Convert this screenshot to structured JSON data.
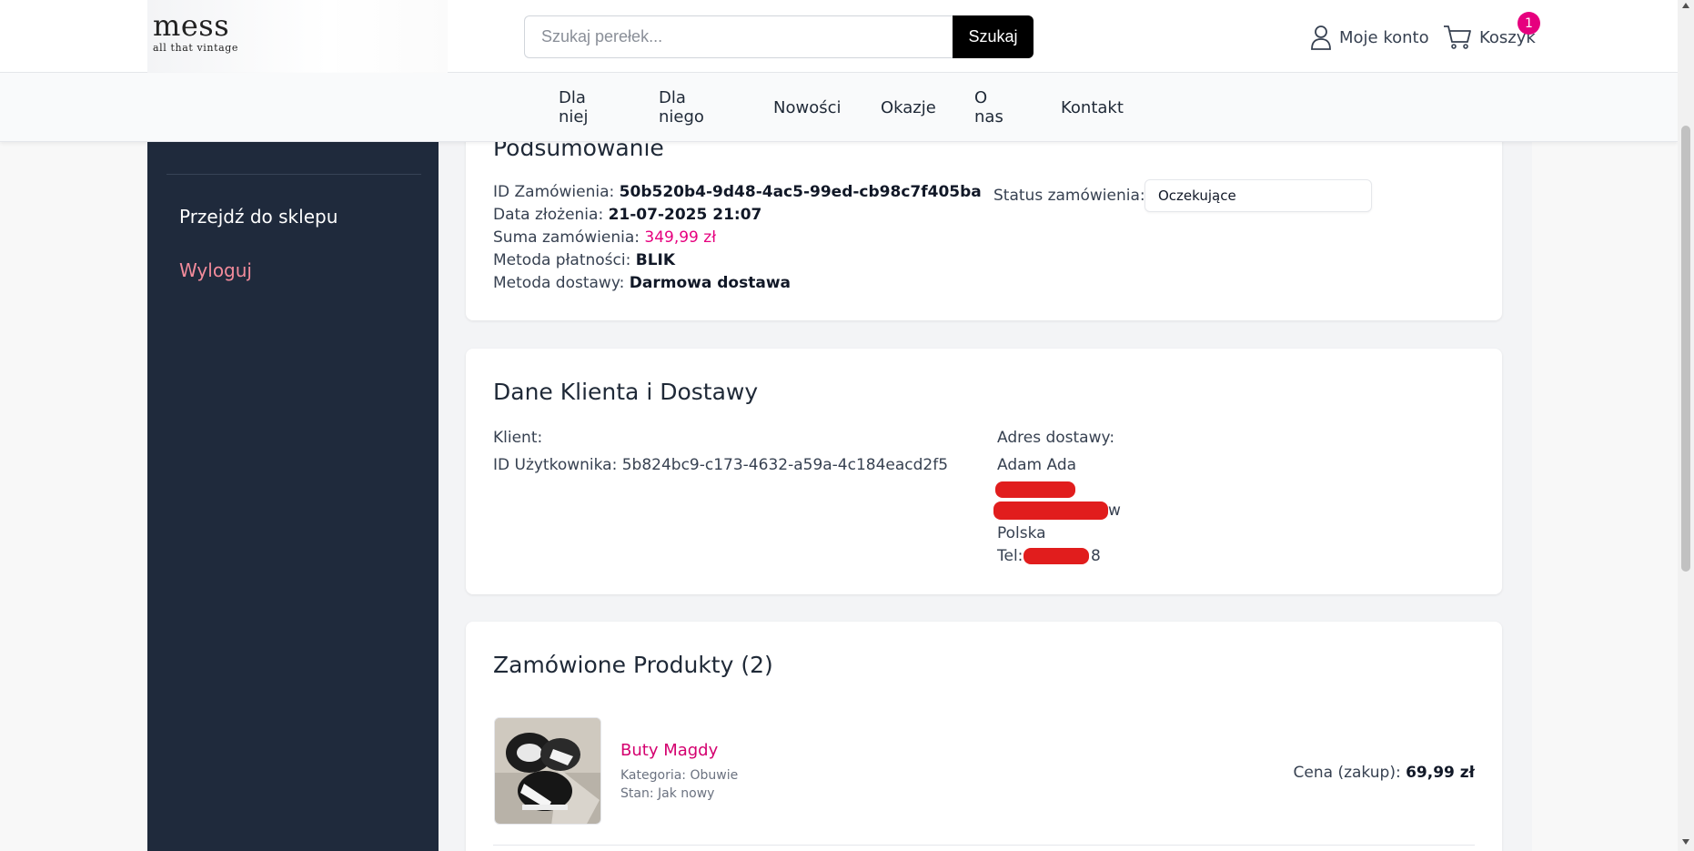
{
  "header": {
    "logo_main": "mess",
    "logo_sub": "all that vintage",
    "search_placeholder": "Szukaj perełek...",
    "search_button": "Szukaj",
    "account_label": "Moje konto",
    "cart_label": "Koszyk",
    "cart_count": "1"
  },
  "nav": {
    "items": [
      "Dla niej",
      "Dla niego",
      "Nowości",
      "Okazje",
      "O nas",
      "Kontakt"
    ]
  },
  "sidebar": {
    "shop_link": "Przejdź do sklepu",
    "logout_link": "Wyloguj"
  },
  "summary": {
    "title": "Podsumowanie",
    "order_id_label": "ID Zamówienia: ",
    "order_id": "50b520b4-9d48-4ac5-99ed-cb98c7f405ba",
    "date_label": "Data złożenia: ",
    "date": "21-07-2025 21:07",
    "total_label": "Suma zamówienia: ",
    "total": "349,99 zł",
    "payment_label": "Metoda płatności: ",
    "payment": "BLIK",
    "shipping_label": "Metoda dostawy: ",
    "shipping": "Darmowa dostawa",
    "status_label": "Status zamówienia:",
    "status_value": "Oczekujące"
  },
  "customer": {
    "title": "Dane Klienta i Dostawy",
    "client_label": "Klient:",
    "user_id_line": "ID Użytkownika: 5b824bc9-c173-4632-a59a-4c184eacd2f5",
    "address_label": "Adres dostawy:",
    "name": "Adam Ada",
    "city_suffix": "w",
    "country": "Polska",
    "phone_prefix": "Tel: ",
    "phone_suffix": "8"
  },
  "products": {
    "title": "Zamówione Produkty (2)",
    "items": [
      {
        "name": "Buty Magdy",
        "category": "Kategoria: Obuwie",
        "condition": "Stan: Jak nowy",
        "price_label": "Cena (zakup): ",
        "price": "69,99 zł"
      }
    ]
  },
  "colors": {
    "accent": "#e6007e",
    "sidebar_bg": "#1f2a3c",
    "logout": "#f28b9b"
  }
}
